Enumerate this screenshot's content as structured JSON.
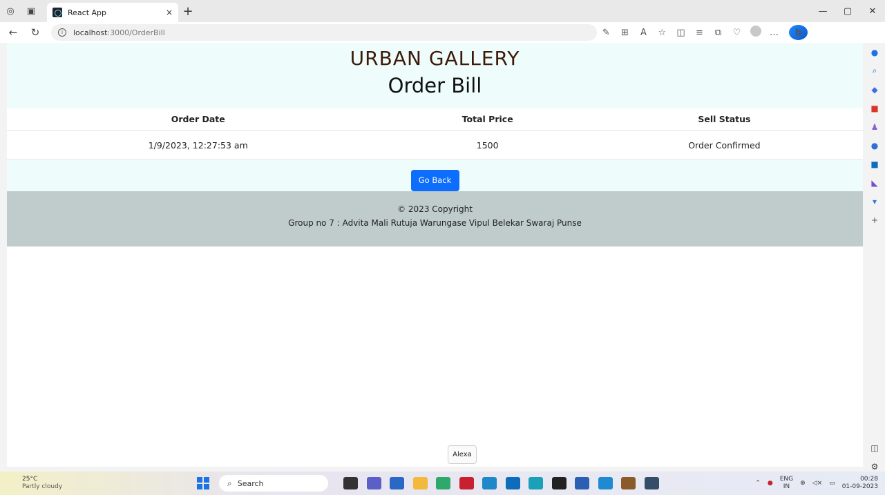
{
  "browser": {
    "tab_title": "React App",
    "tab_close": "×",
    "new_tab": "+",
    "url_host": "localhost",
    "url_path": ":3000/OrderBill",
    "win_minimize": "—",
    "win_restore": "▢",
    "win_close": "✕"
  },
  "header": {
    "brand": "URBAN GALLERY",
    "title": "Order Bill"
  },
  "table": {
    "columns": [
      "Order Date",
      "Total Price",
      "Sell Status"
    ],
    "rows": [
      [
        "1/9/2023, 12:27:53 am",
        "1500",
        "Order Confirmed"
      ]
    ]
  },
  "actions": {
    "back_label": "Go Back"
  },
  "footer": {
    "copyright": "© 2023 Copyright",
    "credits": "Group no 7 : Advita Mali Rutuja Warungase Vipul Belekar Swaraj Punse"
  },
  "tooltip": "Alexa",
  "taskbar": {
    "temperature": "25°C",
    "weather": "Partly cloudy",
    "search_placeholder": "Search",
    "lang_top": "ENG",
    "lang_bottom": "IN",
    "time": "00:28",
    "date": "01-09-2023"
  },
  "colors": {
    "header_bg": "#effcfc",
    "brand_text": "#3d1a0a",
    "button_bg": "#0d6efd",
    "footer_bg": "#bfcccb"
  }
}
